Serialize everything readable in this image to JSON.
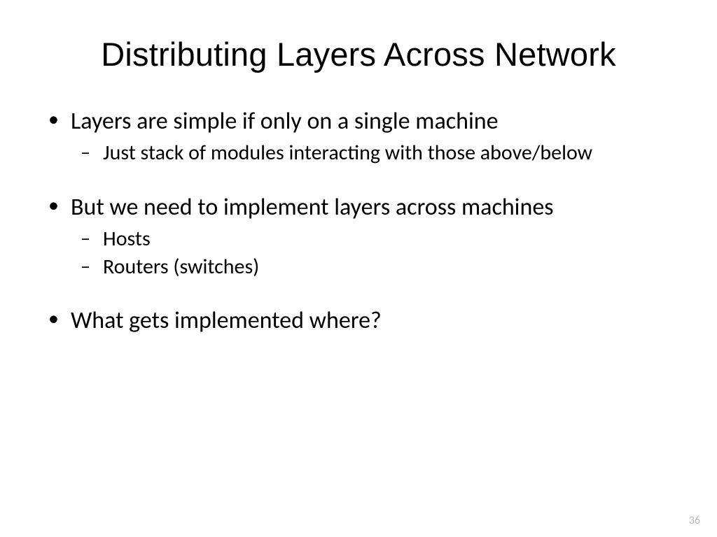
{
  "title": "Distributing Layers Across Network",
  "bullets": [
    {
      "text": "Layers are simple if only on a single machine",
      "sub": [
        "Just stack of modules interacting with those above/below"
      ]
    },
    {
      "text": "But we need to implement layers across machines",
      "sub": [
        "Hosts",
        "Routers (switches)"
      ]
    },
    {
      "text": "What gets implemented where?",
      "sub": []
    }
  ],
  "page_number": "36"
}
